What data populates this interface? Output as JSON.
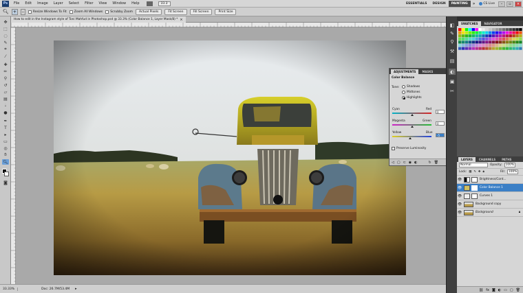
{
  "menubar": {
    "logo": "Ps",
    "items": [
      "File",
      "Edit",
      "Image",
      "Layer",
      "Select",
      "Filter",
      "View",
      "Window",
      "Help"
    ],
    "zoom_value": "33.3",
    "workspaces": [
      "ESSENTIALS",
      "DESIGN",
      "PAINTING"
    ],
    "cs_live": "CS Live"
  },
  "options": {
    "resize_windows": "Resize Windows To Fit",
    "zoom_all": "Zoom All Windows",
    "scrubby_zoom": "Scrubby Zoom",
    "actual_pixels": "Actual Pixels",
    "fit_screen": "Fit Screen",
    "fill_screen": "Fill Screen",
    "print_size": "Print Size"
  },
  "document": {
    "tab_title": "How to edit in the Instagram style of Toni Mahfud in Photoshop.psd @ 33.3% (Color Balance 1, Layer Mask/8) *",
    "close": "×"
  },
  "status": {
    "zoom": "33.33%",
    "doc_size": "Doc: 26.7M/53.4M"
  },
  "swatches_panel": {
    "tabs": [
      "SWATCHES",
      "NAVIGATOR"
    ]
  },
  "adjustments": {
    "tabs": [
      "ADJUSTMENTS",
      "MASKS"
    ],
    "title": "Color Balance",
    "tone_label": "Tone:",
    "tones": [
      "Shadows",
      "Midtones",
      "Highlights"
    ],
    "selected_tone": "Highlights",
    "sliders": [
      {
        "left": "Cyan",
        "right": "Red",
        "value": "0",
        "position": 0.5
      },
      {
        "left": "Magenta",
        "right": "Green",
        "value": "0",
        "position": 0.5
      },
      {
        "left": "Yellow",
        "right": "Blue",
        "value": "-5",
        "position": 0.46
      }
    ],
    "preserve_luminosity": "Preserve Luminosity"
  },
  "layers_panel": {
    "tabs": [
      "LAYERS",
      "CHANNELS",
      "PATHS"
    ],
    "blend_mode": "Normal",
    "opacity_label": "Opacity:",
    "opacity": "100%",
    "lock_label": "Lock:",
    "fill_label": "Fill:",
    "fill": "100%",
    "layers": [
      {
        "name": "Brightness/Cont...",
        "active": false
      },
      {
        "name": "Color Balance 1",
        "active": true
      },
      {
        "name": "Curves 1",
        "active": false
      },
      {
        "name": "Background copy",
        "active": false
      },
      {
        "name": "Background",
        "active": false
      }
    ]
  },
  "colors": {
    "accent": "#3b7fc6",
    "panel": "#d6d6d6",
    "canvas_bg": "#a9a9a9"
  }
}
